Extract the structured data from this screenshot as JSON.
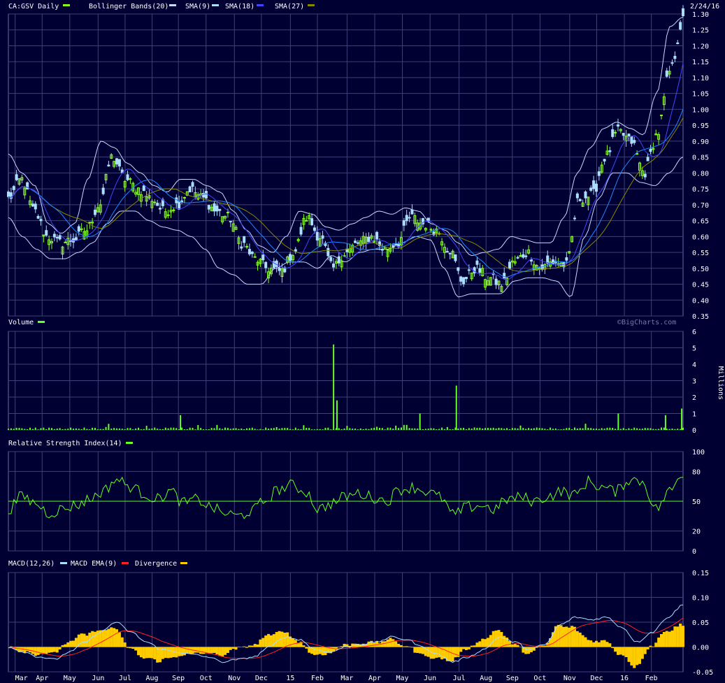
{
  "colors": {
    "background": "#000033",
    "grid": "#40407a",
    "price_up": "#88ff22",
    "price_down": "#aaddff",
    "bollinger": "#c8d8ff",
    "sma9": "#aaddff",
    "sma18": "#4444ff",
    "sma27": "#2288ff",
    "sma27_dark": "#888800",
    "volume": "#66ff22",
    "rsi": "#66ff22",
    "macd": "#aaddff",
    "macd_ema": "#ff2222",
    "divergence": "#ffcc00"
  },
  "header": {
    "symbol_label": "CA:GSV Daily",
    "bollinger_label": "Bollinger Bands(20)",
    "sma9_label": "SMA(9)",
    "sma18_label": "SMA(18)",
    "sma27_label": "SMA(27)",
    "date_label": "2/24/16",
    "watermark": "©BigCharts.com"
  },
  "volume_panel": {
    "title": "Volume",
    "unit_label": "Millions"
  },
  "rsi_panel": {
    "title": "Relative Strength Index(14)"
  },
  "macd_panel": {
    "title": "MACD(12,26)",
    "ema_label": "MACD EMA(9)",
    "divergence_label": "Divergence"
  },
  "chart_data": [
    {
      "type": "candlestick",
      "title": "CA:GSV Daily",
      "ylim": [
        0.35,
        1.3
      ],
      "yticks": [
        "1.30",
        "1.25",
        "1.20",
        "1.15",
        "1.10",
        "1.05",
        "1.00",
        "0.95",
        "0.90",
        "0.85",
        "0.80",
        "0.75",
        "0.70",
        "0.65",
        "0.60",
        "0.55",
        "0.50",
        "0.45",
        "0.40",
        "0.35"
      ],
      "x_labels": [
        "Mar",
        "Apr",
        "May",
        "Jun",
        "Jul",
        "Aug",
        "Sep",
        "Oct",
        "Nov",
        "Dec",
        "15",
        "Feb",
        "Mar",
        "Apr",
        "May",
        "Jun",
        "Jul",
        "Aug",
        "Sep",
        "Oct",
        "Nov",
        "Dec",
        "16",
        "Feb"
      ],
      "close_anchors": [
        0.72,
        0.78,
        0.68,
        0.6,
        0.58,
        0.59,
        0.62,
        0.7,
        0.85,
        0.78,
        0.75,
        0.72,
        0.68,
        0.7,
        0.75,
        0.72,
        0.68,
        0.66,
        0.58,
        0.53,
        0.5,
        0.49,
        0.55,
        0.66,
        0.6,
        0.5,
        0.55,
        0.58,
        0.6,
        0.56,
        0.58,
        0.66,
        0.64,
        0.62,
        0.56,
        0.46,
        0.5,
        0.47,
        0.45,
        0.52,
        0.55,
        0.5,
        0.52,
        0.51,
        0.72,
        0.73,
        0.85,
        0.93,
        0.9,
        0.8,
        0.92,
        1.12,
        1.28
      ],
      "series": [
        {
          "name": "Bollinger Bands(20)",
          "upper_anchors": [
            0.86,
            0.8,
            0.76,
            0.64,
            0.61,
            0.64,
            0.78,
            0.9,
            0.88,
            0.83,
            0.8,
            0.76,
            0.74,
            0.78,
            0.78,
            0.76,
            0.74,
            0.68,
            0.62,
            0.57,
            0.55,
            0.6,
            0.68,
            0.67,
            0.63,
            0.62,
            0.64,
            0.66,
            0.68,
            0.67,
            0.69,
            0.68,
            0.64,
            0.62,
            0.58,
            0.54,
            0.55,
            0.56,
            0.6,
            0.59,
            0.58,
            0.58,
            0.66,
            0.8,
            0.88,
            0.94,
            0.96,
            0.94,
            0.92,
            1.05,
            1.26,
            1.29
          ],
          "lower_anchors": [
            0.66,
            0.6,
            0.56,
            0.53,
            0.53,
            0.55,
            0.58,
            0.64,
            0.68,
            0.68,
            0.65,
            0.63,
            0.62,
            0.6,
            0.56,
            0.5,
            0.48,
            0.45,
            0.45,
            0.5,
            0.52,
            0.52,
            0.5,
            0.54,
            0.52,
            0.55,
            0.56,
            0.56,
            0.58,
            0.6,
            0.59,
            0.5,
            0.41,
            0.42,
            0.42,
            0.42,
            0.46,
            0.47,
            0.47,
            0.46,
            0.41,
            0.6,
            0.72,
            0.8,
            0.8,
            0.77,
            0.76,
            0.8,
            0.85
          ]
        },
        {
          "name": "SMA(9)"
        },
        {
          "name": "SMA(18)"
        },
        {
          "name": "SMA(27)"
        }
      ]
    },
    {
      "type": "bar",
      "title": "Volume",
      "ylabel": "Millions",
      "ylim": [
        0,
        6
      ],
      "yticks": [
        "6",
        "5",
        "4",
        "3",
        "2",
        "1",
        "0"
      ],
      "spikes": [
        {
          "pos": 0.255,
          "value": 0.9
        },
        {
          "pos": 0.482,
          "value": 5.2
        },
        {
          "pos": 0.487,
          "value": 1.8
        },
        {
          "pos": 0.61,
          "value": 1.0
        },
        {
          "pos": 0.664,
          "value": 2.7
        },
        {
          "pos": 0.904,
          "value": 1.0
        },
        {
          "pos": 0.974,
          "value": 0.9
        },
        {
          "pos": 0.998,
          "value": 1.3
        }
      ]
    },
    {
      "type": "line",
      "title": "Relative Strength Index(14)",
      "ylim": [
        0,
        100
      ],
      "yticks": [
        "100",
        "80",
        "50",
        "20",
        "0"
      ],
      "reference_line": 50,
      "value_anchors": [
        42,
        55,
        48,
        38,
        42,
        46,
        52,
        60,
        72,
        65,
        58,
        52,
        60,
        48,
        52,
        44,
        38,
        35,
        40,
        50,
        62,
        66,
        60,
        42,
        48,
        55,
        58,
        54,
        50,
        62,
        64,
        60,
        54,
        36,
        44,
        46,
        42,
        52,
        54,
        50,
        55,
        60,
        56,
        70,
        64,
        60,
        72,
        70,
        42,
        60,
        78
      ]
    },
    {
      "type": "line",
      "title": "MACD(12,26)",
      "ylim": [
        -0.05,
        0.15
      ],
      "yticks": [
        "0.15",
        "0.10",
        "0.05",
        "0.00",
        "-0.05"
      ],
      "macd_anchors": [
        0.0,
        -0.01,
        -0.02,
        -0.025,
        -0.01,
        0.01,
        0.03,
        0.05,
        0.03,
        0.01,
        -0.005,
        -0.01,
        -0.015,
        -0.02,
        -0.03,
        -0.025,
        -0.02,
        0.0,
        0.02,
        0.015,
        -0.005,
        -0.01,
        0.0,
        0.005,
        0.01,
        0.02,
        0.015,
        0.0,
        -0.015,
        -0.03,
        -0.02,
        -0.005,
        0.02,
        0.01,
        -0.005,
        0.005,
        0.045,
        0.06,
        0.055,
        0.06,
        0.04,
        0.01,
        0.03,
        0.06,
        0.085
      ]
    }
  ]
}
